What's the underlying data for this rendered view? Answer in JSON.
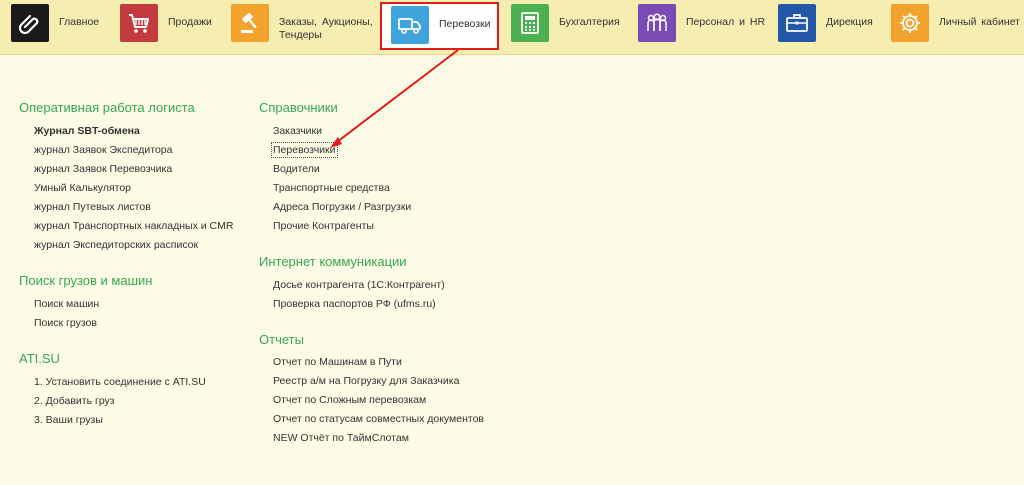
{
  "sections": [
    {
      "label": "Главное",
      "icon": "paperclip-icon",
      "color": "#1a1a1a"
    },
    {
      "label": "Продажи",
      "icon": "shopping-cart-icon",
      "color": "#c33a3f"
    },
    {
      "label": "Заказы, Аукционы,",
      "label2": "Тендеры",
      "icon": "gavel-icon",
      "color": "#f2a32e"
    },
    {
      "label": "Перевозки",
      "icon": "truck-icon",
      "color": "#3fa3dd",
      "active": true
    },
    {
      "label": "Бухгалтерия",
      "icon": "calculator-icon",
      "color": "#4caf50"
    },
    {
      "label": "Персонал и HR",
      "icon": "people-icon",
      "color": "#7a4bb5"
    },
    {
      "label": "Дирекция",
      "icon": "briefcase-icon",
      "color": "#2457a8"
    },
    {
      "label": "Личный кабинет",
      "icon": "gear-icon",
      "color": "#f2a32e"
    }
  ],
  "groups": {
    "ops": {
      "title": "Оперативная работа логиста",
      "items": [
        "Журнал SBT-обмена",
        "журнал Заявок Экспедитора",
        "журнал Заявок Перевозчика",
        "Умный Калькулятор",
        "журнал Путевых листов",
        "журнал Транспортных накладных и CMR",
        "журнал Экспедиторских расписок"
      ]
    },
    "search": {
      "title": "Поиск грузов и машин",
      "items": [
        "Поиск машин",
        "Поиск грузов"
      ]
    },
    "ati": {
      "title": "ATI.SU",
      "items": [
        "1. Установить соединение с ATI.SU",
        "2. Добавить груз",
        "3. Ваши грузы"
      ]
    },
    "refs": {
      "title": "Справочники",
      "items": [
        "Заказчики",
        "Перевозчики",
        "Водители",
        "Транспортные средства",
        "Адреса Погрузки / Разгрузки",
        "Прочие Контрагенты"
      ]
    },
    "internet": {
      "title": "Интернет коммуникации",
      "items": [
        "Досье контрагента (1С:Контрагент)",
        "Проверка паспортов РФ (ufms.ru)"
      ]
    },
    "reports": {
      "title": "Отчеты",
      "items": [
        "Отчет по Машинам в Пути",
        "Реестр а/м на Погрузку для Заказчика",
        "Отчет по Сложным перевозкам",
        "Отчет по статусам совместных документов",
        "NEW Отчёт по ТаймСлотам"
      ]
    }
  },
  "colors": {
    "group_title": "#3aa654",
    "highlight_border": "#e21b1b",
    "arrow": "#e21b1b",
    "topbar": "#f6edb0",
    "background": "#fbfbe6"
  }
}
